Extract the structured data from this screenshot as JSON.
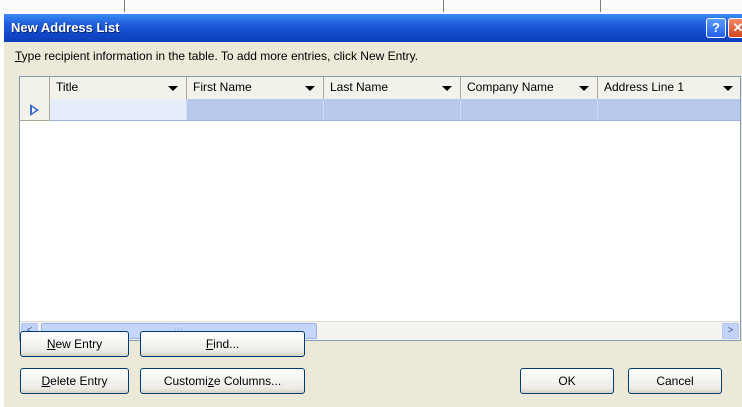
{
  "dialog": {
    "title": "New Address List",
    "help_glyph": "?",
    "close_glyph": "✕",
    "instruction_ak": "T",
    "instruction_rest": "ype recipient information in the table.  To add more entries, click New Entry."
  },
  "grid": {
    "columns": [
      {
        "label": "Title"
      },
      {
        "label": "First Name"
      },
      {
        "label": "Last Name"
      },
      {
        "label": "Company Name"
      },
      {
        "label": "Address Line 1"
      }
    ],
    "rows": [
      {
        "title": "",
        "first_name": "",
        "last_name": "",
        "company_name": "",
        "address_line_1": ""
      }
    ],
    "scroll_left_glyph": "<",
    "scroll_right_glyph": ">",
    "thumb_grip": "|||"
  },
  "buttons": {
    "new_entry": {
      "ak": "N",
      "rest": "ew Entry"
    },
    "find": {
      "ak": "F",
      "rest": "ind..."
    },
    "delete_entry": {
      "ak": "D",
      "rest": "elete Entry"
    },
    "customize_columns": {
      "pre": "Customi",
      "ak": "z",
      "post": "e Columns..."
    },
    "ok": "OK",
    "cancel": "Cancel"
  },
  "colors": {
    "title_bar": "#1148c9",
    "selected_row": "#b8c9ee",
    "dialog_face": "#ece9d8"
  }
}
